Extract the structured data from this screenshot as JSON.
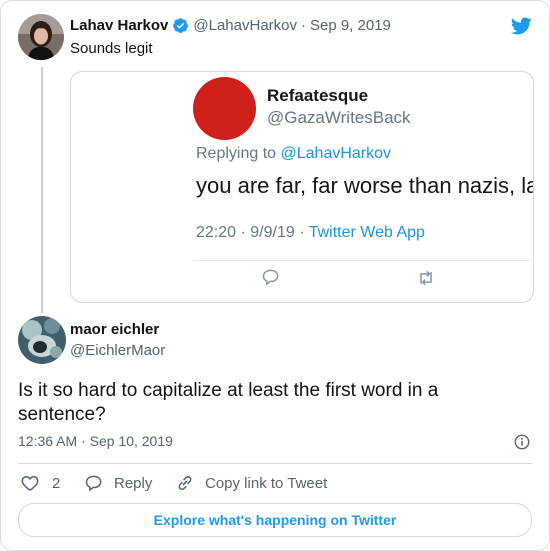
{
  "colors": {
    "brand_blue": "#1d9bf0",
    "text": "#0f1419",
    "muted": "#536471",
    "border": "#cfd9de",
    "embed_avatar": "#d0201c"
  },
  "parent_tweet": {
    "author_name": "Lahav Harkov",
    "author_handle": "@LahavHarkov",
    "separator": "·",
    "date": "Sep 9, 2019",
    "text": "Sounds legit",
    "embedded_screenshot": {
      "author_name": "Refaatesque",
      "author_handle": "@GazaWritesBack",
      "replying_prefix": "Replying to",
      "replying_to": "@LahavHarkov",
      "text": "you are far, far worse than nazis, laha",
      "time": "22:20",
      "sep1": "·",
      "date": "9/9/19",
      "sep2": "·",
      "app": "Twitter Web App"
    }
  },
  "reply_tweet": {
    "author_name": "maor eichler",
    "author_handle": "@EichlerMaor",
    "text": "Is it so hard to capitalize at least the first word in a sentence?",
    "time": "12:36 AM",
    "separator": "·",
    "date": "Sep 10, 2019",
    "like_count": "2",
    "reply_label": "Reply",
    "copy_link_label": "Copy link to Tweet"
  },
  "footer": {
    "explore_label": "Explore what's happening on Twitter"
  },
  "icons": [
    "twitter-bird-icon",
    "verified-badge-icon",
    "reply-icon",
    "retweet-icon",
    "info-icon",
    "heart-icon",
    "link-icon"
  ]
}
